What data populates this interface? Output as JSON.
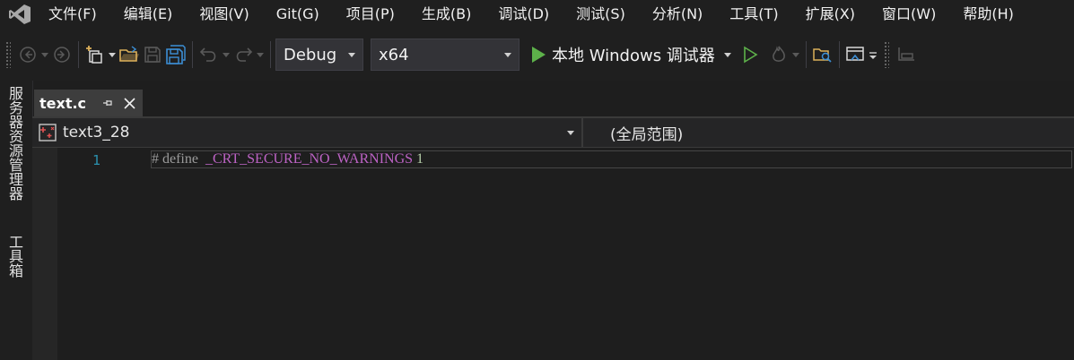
{
  "menubar": {
    "items": [
      "文件(F)",
      "编辑(E)",
      "视图(V)",
      "Git(G)",
      "项目(P)",
      "生成(B)",
      "调试(D)",
      "测试(S)",
      "分析(N)",
      "工具(T)",
      "扩展(X)",
      "窗口(W)",
      "帮助(H)"
    ]
  },
  "toolbar": {
    "configuration": "Debug",
    "platform": "x64",
    "run_label": "本地 Windows 调试器"
  },
  "sidebar": {
    "tabs": [
      "服务器资源管理器",
      "工具箱"
    ]
  },
  "document": {
    "tab_name": "text.c"
  },
  "navbar": {
    "project": "text3_28",
    "scope": "(全局范围)"
  },
  "editor": {
    "line_number": "1",
    "code": {
      "directive": "# define",
      "macro": "_CRT_SECURE_NO_WARNINGS",
      "value": "1"
    }
  },
  "colors": {
    "background": "#1e1e1e",
    "chrome": "#1f1f1f",
    "run_green": "#5db14a",
    "folder_yellow": "#dcb05a",
    "save_blue": "#3c8fd6",
    "line_number": "#2b91af",
    "macro_purple": "#bd63c5"
  }
}
